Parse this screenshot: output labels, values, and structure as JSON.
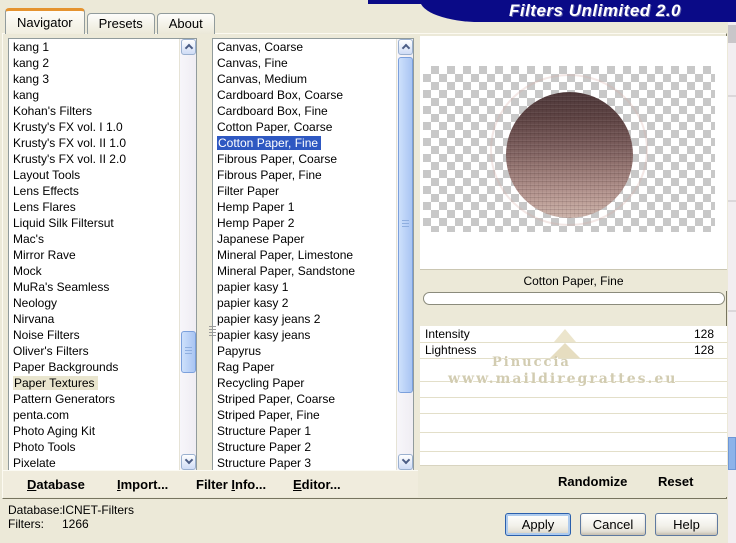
{
  "window": {
    "title": "Filters Unlimited 2.0"
  },
  "tabs": [
    {
      "label": "Navigator",
      "active": true
    },
    {
      "label": "Presets",
      "active": false
    },
    {
      "label": "About",
      "active": false
    }
  ],
  "left_list": {
    "selected": "Paper Textures",
    "items": [
      "kang 1",
      "kang 2",
      "kang 3",
      "kang",
      "Kohan's Filters",
      "Krusty's FX vol. I 1.0",
      "Krusty's FX vol. II 1.0",
      "Krusty's FX vol. II 2.0",
      "Layout Tools",
      "Lens Effects",
      "Lens Flares",
      "Liquid Silk Filtersut",
      "Mac's",
      "Mirror Rave",
      "Mock",
      "MuRa's Seamless",
      "Neology",
      "Nirvana",
      "Noise Filters",
      "Oliver's Filters",
      "Paper Backgrounds",
      "Paper Textures",
      "Pattern Generators",
      "penta.com",
      "Photo Aging Kit",
      "Photo Tools",
      "Pixelate"
    ]
  },
  "filter_list": {
    "selected": "Cotton Paper, Fine",
    "items": [
      "Canvas, Coarse",
      "Canvas, Fine",
      "Canvas, Medium",
      "Cardboard Box, Coarse",
      "Cardboard Box, Fine",
      "Cotton Paper, Coarse",
      "Cotton Paper, Fine",
      "Fibrous Paper, Coarse",
      "Fibrous Paper, Fine",
      "Filter Paper",
      "Hemp Paper 1",
      "Hemp Paper 2",
      "Japanese Paper",
      "Mineral Paper, Limestone",
      "Mineral Paper, Sandstone",
      "papier kasy 1",
      "papier kasy 2",
      "papier kasy jeans 2",
      "papier kasy jeans",
      "Papyrus",
      "Rag Paper",
      "Recycling Paper",
      "Striped Paper, Coarse",
      "Striped Paper, Fine",
      "Structure Paper 1",
      "Structure Paper 2",
      "Structure Paper 3"
    ]
  },
  "toolbar": {
    "items": [
      {
        "label": "Database",
        "accel_index": 0
      },
      {
        "label": "Import...",
        "accel_index": 0
      },
      {
        "label": "Filter Info...",
        "accel_index": 7
      },
      {
        "label": "Editor...",
        "accel_index": 0
      }
    ]
  },
  "preview": {
    "filter_name": "Cotton Paper, Fine",
    "watermark_line1": "Pinuccia",
    "watermark_line2": "www.maildiregrattes.eu"
  },
  "sliders": [
    {
      "label": "Intensity",
      "value": "128"
    },
    {
      "label": "Lightness",
      "value": "128"
    }
  ],
  "actions": {
    "randomize": "Randomize",
    "reset": "Reset"
  },
  "status": {
    "database_label": "Database:",
    "database_value": "ICNET-Filters",
    "filters_label": "Filters:",
    "filters_value": "1266"
  },
  "buttons": {
    "apply": "Apply",
    "cancel": "Cancel",
    "help": "Help"
  },
  "colors": {
    "title_bar": "#0a0a87",
    "selection_blue": "#2e58c2",
    "inactive_selection": "#e9e5ce",
    "tab_accent_orange": "#e5932f",
    "dialog_face": "#ece9d8"
  }
}
